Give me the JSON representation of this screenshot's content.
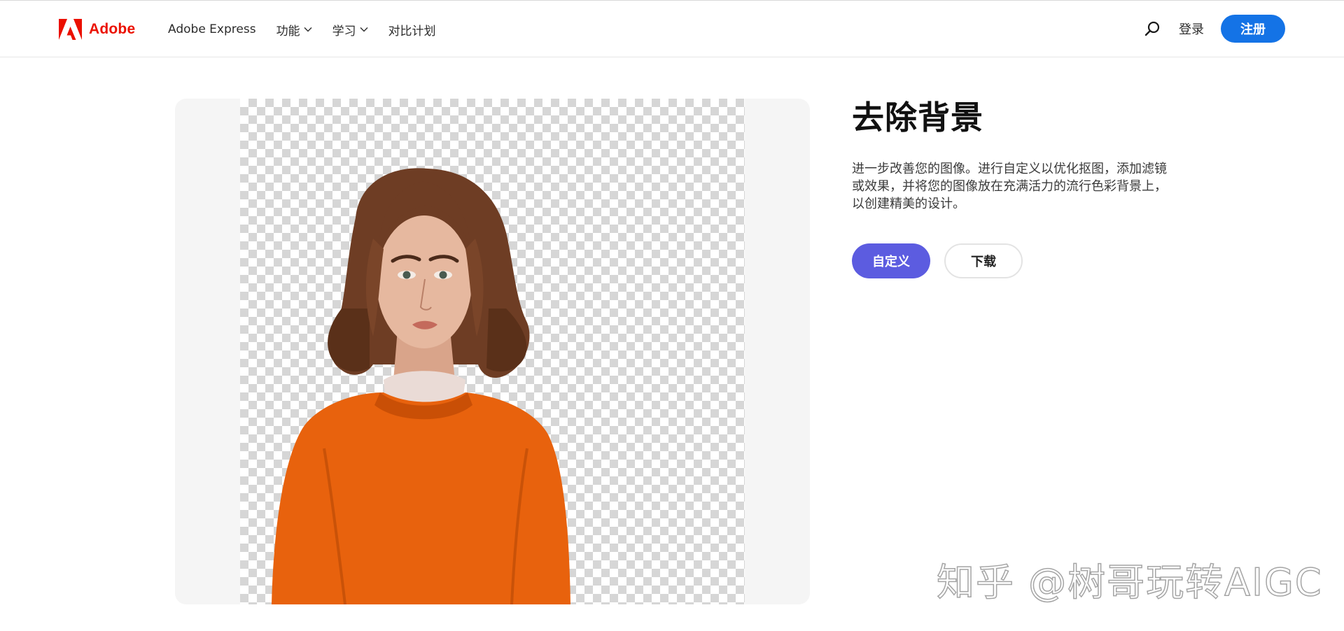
{
  "header": {
    "brand_name": "Adobe",
    "brand_color": "#eb1000",
    "nav": [
      {
        "label": "Adobe Express",
        "has_dropdown": false
      },
      {
        "label": "功能",
        "has_dropdown": true
      },
      {
        "label": "学习",
        "has_dropdown": true
      },
      {
        "label": "对比计划",
        "has_dropdown": false
      }
    ],
    "search_icon": "search-icon",
    "login_label": "登录",
    "signup_label": "注册",
    "signup_color": "#1473e6"
  },
  "main": {
    "title": "去除背景",
    "description": "进一步改善您的图像。进行自定义以优化抠图，添加滤镜或效果，并将您的图像放在充满活力的流行色彩背景上，以创建精美的设计。",
    "primary_button": "自定义",
    "primary_color": "#5c5ce0",
    "secondary_button": "下载"
  },
  "watermark": "知乎 @树哥玩转AIGC"
}
